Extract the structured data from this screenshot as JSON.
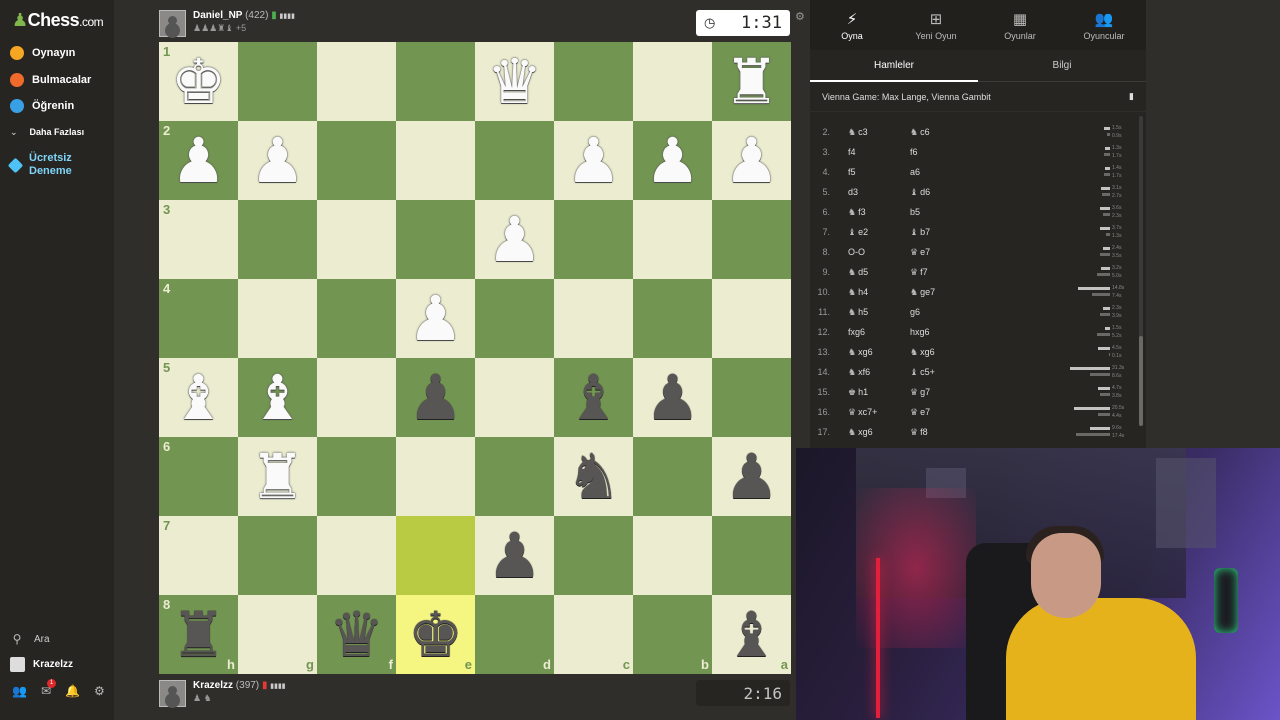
{
  "sidebar": {
    "logo": "Chess",
    "logo_domain": ".com",
    "items": [
      {
        "label": "Oynayın",
        "icon": "play-icon",
        "color": "#f5a623"
      },
      {
        "label": "Bulmacalar",
        "icon": "puzzle-icon",
        "color": "#f06b2b"
      },
      {
        "label": "Öğrenin",
        "icon": "learn-icon",
        "color": "#3aa0e5"
      },
      {
        "label": "Daha Fazlası",
        "icon": "chevron-down-icon"
      },
      {
        "label": "Ücretsiz Deneme",
        "icon": "diamond-icon",
        "color": "#4fc3f7"
      }
    ],
    "search_label": "Ara",
    "user_label": "Krazelzz",
    "notification_count": "1"
  },
  "top_player": {
    "name": "Daniel_NP",
    "rating": "(422)",
    "captured": "+5",
    "clock": "1:31"
  },
  "bottom_player": {
    "name": "Krazelzz",
    "rating": "(397)",
    "clock": "2:16"
  },
  "board": {
    "ranks": [
      "1",
      "2",
      "3",
      "4",
      "5",
      "6",
      "7",
      "8"
    ],
    "files": [
      "h",
      "g",
      "f",
      "e",
      "d",
      "c",
      "b",
      "a"
    ],
    "position": [
      [
        "wK",
        "",
        "",
        "",
        "wQ",
        "",
        "",
        "wR"
      ],
      [
        "wP",
        "wP",
        "",
        "",
        "",
        "wP",
        "wP",
        "wP"
      ],
      [
        "",
        "",
        "",
        "",
        "wP",
        "",
        "",
        ""
      ],
      [
        "",
        "",
        "",
        "wP",
        "",
        "",
        "",
        ""
      ],
      [
        "wB",
        "wB",
        "",
        "bP",
        "",
        "bB",
        "bP",
        ""
      ],
      [
        "",
        "wR",
        "",
        "",
        "",
        "bN",
        "",
        "bP"
      ],
      [
        "",
        "",
        "",
        "",
        "bP",
        "",
        "",
        ""
      ],
      [
        "bR",
        "",
        "bQ",
        "bK",
        "",
        "",
        "",
        "bB"
      ]
    ],
    "highlight_squares": [
      "e7",
      "e8"
    ]
  },
  "panel": {
    "tabs": [
      {
        "label": "Oyna",
        "icon": "lightning-icon"
      },
      {
        "label": "Yeni Oyun",
        "icon": "plus-icon"
      },
      {
        "label": "Oyunlar",
        "icon": "board-icon"
      },
      {
        "label": "Oyuncular",
        "icon": "players-icon"
      }
    ],
    "subtabs": [
      "Hamleler",
      "Bilgi"
    ],
    "opening": "Vienna Game: Max Lange, Vienna Gambit",
    "moves": [
      {
        "n": "2.",
        "w": "c3",
        "wp": "♞",
        "b": "c6",
        "bp": "♞",
        "tw": "1.5s",
        "tb": "0.9s",
        "bw": 6,
        "bb": 3
      },
      {
        "n": "3.",
        "w": "f4",
        "wp": "",
        "b": "f6",
        "bp": "",
        "tw": "1.3s",
        "tb": "1.7s",
        "bw": 5,
        "bb": 6
      },
      {
        "n": "4.",
        "w": "f5",
        "wp": "",
        "b": "a6",
        "bp": "",
        "tw": "1.4s",
        "tb": "1.7s",
        "bw": 5,
        "bb": 6
      },
      {
        "n": "5.",
        "w": "d3",
        "wp": "",
        "b": "d6",
        "bp": "♝",
        "tw": "3.1s",
        "tb": "2.7s",
        "bw": 9,
        "bb": 8
      },
      {
        "n": "6.",
        "w": "f3",
        "wp": "♞",
        "b": "b5",
        "bp": "",
        "tw": "3.6s",
        "tb": "2.3s",
        "bw": 10,
        "bb": 7
      },
      {
        "n": "7.",
        "w": "e2",
        "wp": "♝",
        "b": "b7",
        "bp": "♝",
        "tw": "3.7s",
        "tb": "1.3s",
        "bw": 10,
        "bb": 4
      },
      {
        "n": "8.",
        "w": "O-O",
        "wp": "",
        "b": "e7",
        "bp": "♛",
        "tw": "2.4s",
        "tb": "3.5s",
        "bw": 7,
        "bb": 10
      },
      {
        "n": "9.",
        "w": "d5",
        "wp": "♞",
        "b": "f7",
        "bp": "♛",
        "tw": "3.2s",
        "tb": "5.0s",
        "bw": 9,
        "bb": 13
      },
      {
        "n": "10.",
        "w": "h4",
        "wp": "♞",
        "b": "ge7",
        "bp": "♞",
        "tw": "14.8s",
        "tb": "7.4s",
        "bw": 32,
        "bb": 18
      },
      {
        "n": "11.",
        "w": "h5",
        "wp": "♞",
        "b": "g6",
        "bp": "",
        "tw": "2.3s",
        "tb": "3.9s",
        "bw": 7,
        "bb": 10
      },
      {
        "n": "12.",
        "w": "fxg6",
        "wp": "",
        "b": "hxg6",
        "bp": "",
        "tw": "1.5s",
        "tb": "5.2s",
        "bw": 5,
        "bb": 13
      },
      {
        "n": "13.",
        "w": "xg6",
        "wp": "♞",
        "b": "xg6",
        "bp": "♞",
        "tw": "4.5s",
        "tb": "0.1s",
        "bw": 12,
        "bb": 1
      },
      {
        "n": "14.",
        "w": "xf6",
        "wp": "♞",
        "b": "c5+",
        "bp": "♝",
        "tw": "31.3s",
        "tb": "8.6s",
        "bw": 40,
        "bb": 20
      },
      {
        "n": "15.",
        "w": "h1",
        "wp": "♚",
        "b": "g7",
        "bp": "♛",
        "tw": "4.7s",
        "tb": "3.8s",
        "bw": 12,
        "bb": 10
      },
      {
        "n": "16.",
        "w": "xc7+",
        "wp": "♛",
        "b": "e7",
        "bp": "♛",
        "tw": "20.5s",
        "tb": "4.4s",
        "bw": 36,
        "bb": 12
      },
      {
        "n": "17.",
        "w": "xg6",
        "wp": "♞",
        "b": "f8",
        "bp": "♛",
        "tw": "9.6s",
        "tb": "17.4s",
        "bw": 20,
        "bb": 34
      }
    ]
  },
  "colors": {
    "board_light": "#ebecd0",
    "board_dark": "#739552",
    "highlight": "#f5f682",
    "accent_green": "#81b64c"
  }
}
